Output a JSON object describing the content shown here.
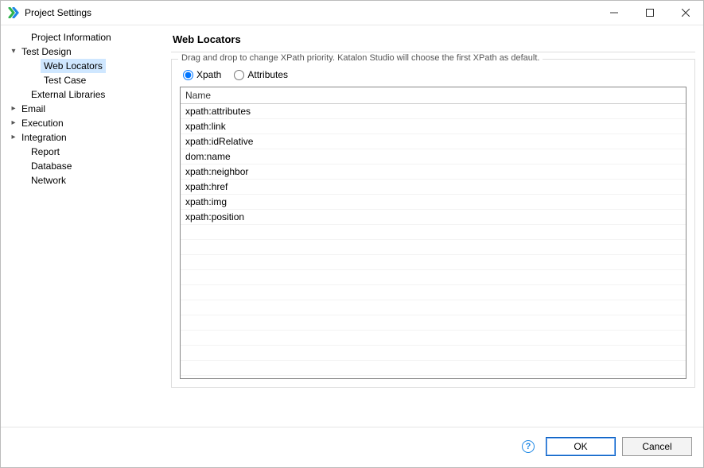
{
  "window": {
    "title": "Project Settings"
  },
  "sidebar": {
    "items": [
      {
        "label": "Project Information",
        "indent": 1,
        "caret": ""
      },
      {
        "label": "Test Design",
        "indent": 0,
        "caret": "▾"
      },
      {
        "label": "Web Locators",
        "indent": 2,
        "caret": "",
        "selected": true
      },
      {
        "label": "Test Case",
        "indent": 2,
        "caret": ""
      },
      {
        "label": "External Libraries",
        "indent": 1,
        "caret": ""
      },
      {
        "label": "Email",
        "indent": 0,
        "caret": "▸"
      },
      {
        "label": "Execution",
        "indent": 0,
        "caret": "▸"
      },
      {
        "label": "Integration",
        "indent": 0,
        "caret": "▸"
      },
      {
        "label": "Report",
        "indent": 1,
        "caret": ""
      },
      {
        "label": "Database",
        "indent": 1,
        "caret": ""
      },
      {
        "label": "Network",
        "indent": 1,
        "caret": ""
      }
    ]
  },
  "panel": {
    "title": "Web Locators",
    "group_legend": "Drag and drop to change XPath priority. Katalon Studio will choose the first XPath as default.",
    "radios": {
      "xpath": "Xpath",
      "attributes": "Attributes",
      "xpath_checked": true
    },
    "table": {
      "header": "Name",
      "rows": [
        "xpath:attributes",
        "xpath:link",
        "xpath:idRelative",
        "dom:name",
        "xpath:neighbor",
        "xpath:href",
        "xpath:img",
        "xpath:position"
      ]
    }
  },
  "footer": {
    "ok": "OK",
    "cancel": "Cancel"
  }
}
